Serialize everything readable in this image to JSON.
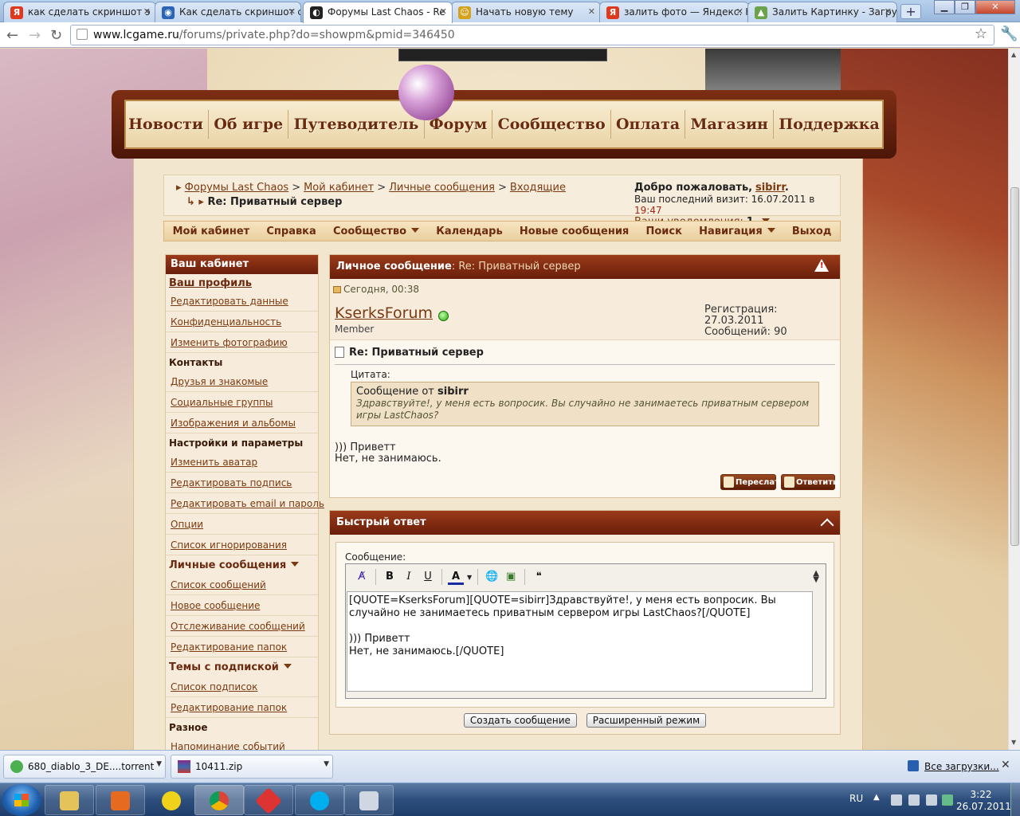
{
  "browser": {
    "tabs": [
      {
        "title": "как сделать скриншот э",
        "fav": "Я",
        "favColor": "#e03a1e"
      },
      {
        "title": "Как сделать скриншот с",
        "fav": "◉",
        "favColor": "#2b63b5"
      },
      {
        "title": "Форумы Last Chaos - Re",
        "fav": "◐",
        "favColor": "#222222"
      },
      {
        "title": "Начать новую тему",
        "fav": "☺",
        "favColor": "#d6a21b"
      },
      {
        "title": "залить фото — Яндекс: Н",
        "fav": "Я",
        "favColor": "#e03a1e"
      },
      {
        "title": "Залить Картинку - Загру",
        "fav": "▲",
        "favColor": "#6ba34a"
      }
    ],
    "new_tab": "+",
    "url_host": "www.lcgame.ru",
    "url_path": "/forums/private.php?do=showpm&pmid=346450"
  },
  "main_nav": [
    "Новости",
    "Об игре",
    "Путеводитель",
    "Форум",
    "Сообщество",
    "Оплата",
    "Магазин",
    "Поддержка"
  ],
  "breadcrumb": {
    "items": [
      "Форумы Last Chaos",
      "Мой кабинет",
      "Личные сообщения",
      "Входящие"
    ],
    "separator": ">",
    "current": "Re: Приватный сервер"
  },
  "welcome": {
    "greeting": "Добро пожаловать,",
    "user": "sibirr",
    "dot": ".",
    "last_visit_label": "Ваш последний визит: 16.07.2011 в",
    "last_visit_time": "19:47",
    "notifications_label": "Ваши уведомления:",
    "notifications_count": "1"
  },
  "sub_nav": [
    "Мой кабинет",
    "Справка",
    "Сообщество",
    "Календарь",
    "Новые сообщения",
    "Поиск",
    "Навигация",
    "Выход"
  ],
  "sidebar": {
    "title": "Ваш кабинет",
    "profile": "Ваш профиль",
    "profile_links": [
      "Редактировать данные",
      "Конфиденциальность",
      "Изменить фотографию"
    ],
    "contacts_head": "Контакты",
    "contacts_links": [
      "Друзья и знакомые",
      "Социальные группы",
      "Изображения и альбомы"
    ],
    "settings_head": "Настройки и параметры",
    "settings_links": [
      "Изменить аватар",
      "Редактировать подпись",
      "Редактировать email и пароль",
      "Опции",
      "Список игнорирования"
    ],
    "pm_head": "Личные сообщения",
    "pm_links": [
      "Список сообщений",
      "Новое сообщение",
      "Отслеживание сообщений",
      "Редактирование папок"
    ],
    "subs_head": "Темы с подпиской",
    "subs_links": [
      "Список подписок",
      "Редактирование папок"
    ],
    "misc_head": "Разное",
    "misc_links": [
      "Напоминание событий"
    ]
  },
  "pm": {
    "title_label": "Личное сообщение",
    "title_rest": ": Re: Приватный сервер",
    "date": "Сегодня, 00:38",
    "author": "KserksForum",
    "rank": "Member",
    "reg": "Регистрация: 27.03.2011",
    "posts": "Сообщений: 90",
    "subject": "Re: Приватный сервер",
    "quote_label": "Цитата:",
    "quote_from": "Сообщение от",
    "quote_user": "sibirr",
    "quote_text": "Здравствуйте!, у меня есть вопросик. Вы случайно не занимаетесь приватным сервером игры LastChaos?",
    "message_line1": "))) Приветт",
    "message_line2": "Нет, не занимаюсь.",
    "forward_btn": "Переслать",
    "reply_btn": "Ответить"
  },
  "quick_reply": {
    "title": "Быстрый ответ",
    "label": "Сообщение:",
    "text": "[QUOTE=KserksForum][QUOTE=sibirr]Здравствуйте!, у меня есть вопросик. Вы случайно не занимаетесь приватным сервером игры LastChaos?[/QUOTE]\n\n))) Приветт\nНет, не занимаюсь.[/QUOTE]",
    "submit": "Создать сообщение",
    "advanced": "Расширенный режим",
    "toolbar": {
      "bold": "B",
      "italic": "I",
      "underline": "U",
      "color": "A"
    }
  },
  "downloads": {
    "items": [
      "680_diablo_3_DE....torrent",
      "10411.zip"
    ],
    "all": "Все загрузки..."
  },
  "taskbar": {
    "lang": "RU",
    "time": "3:22",
    "date": "26.07.2011"
  }
}
